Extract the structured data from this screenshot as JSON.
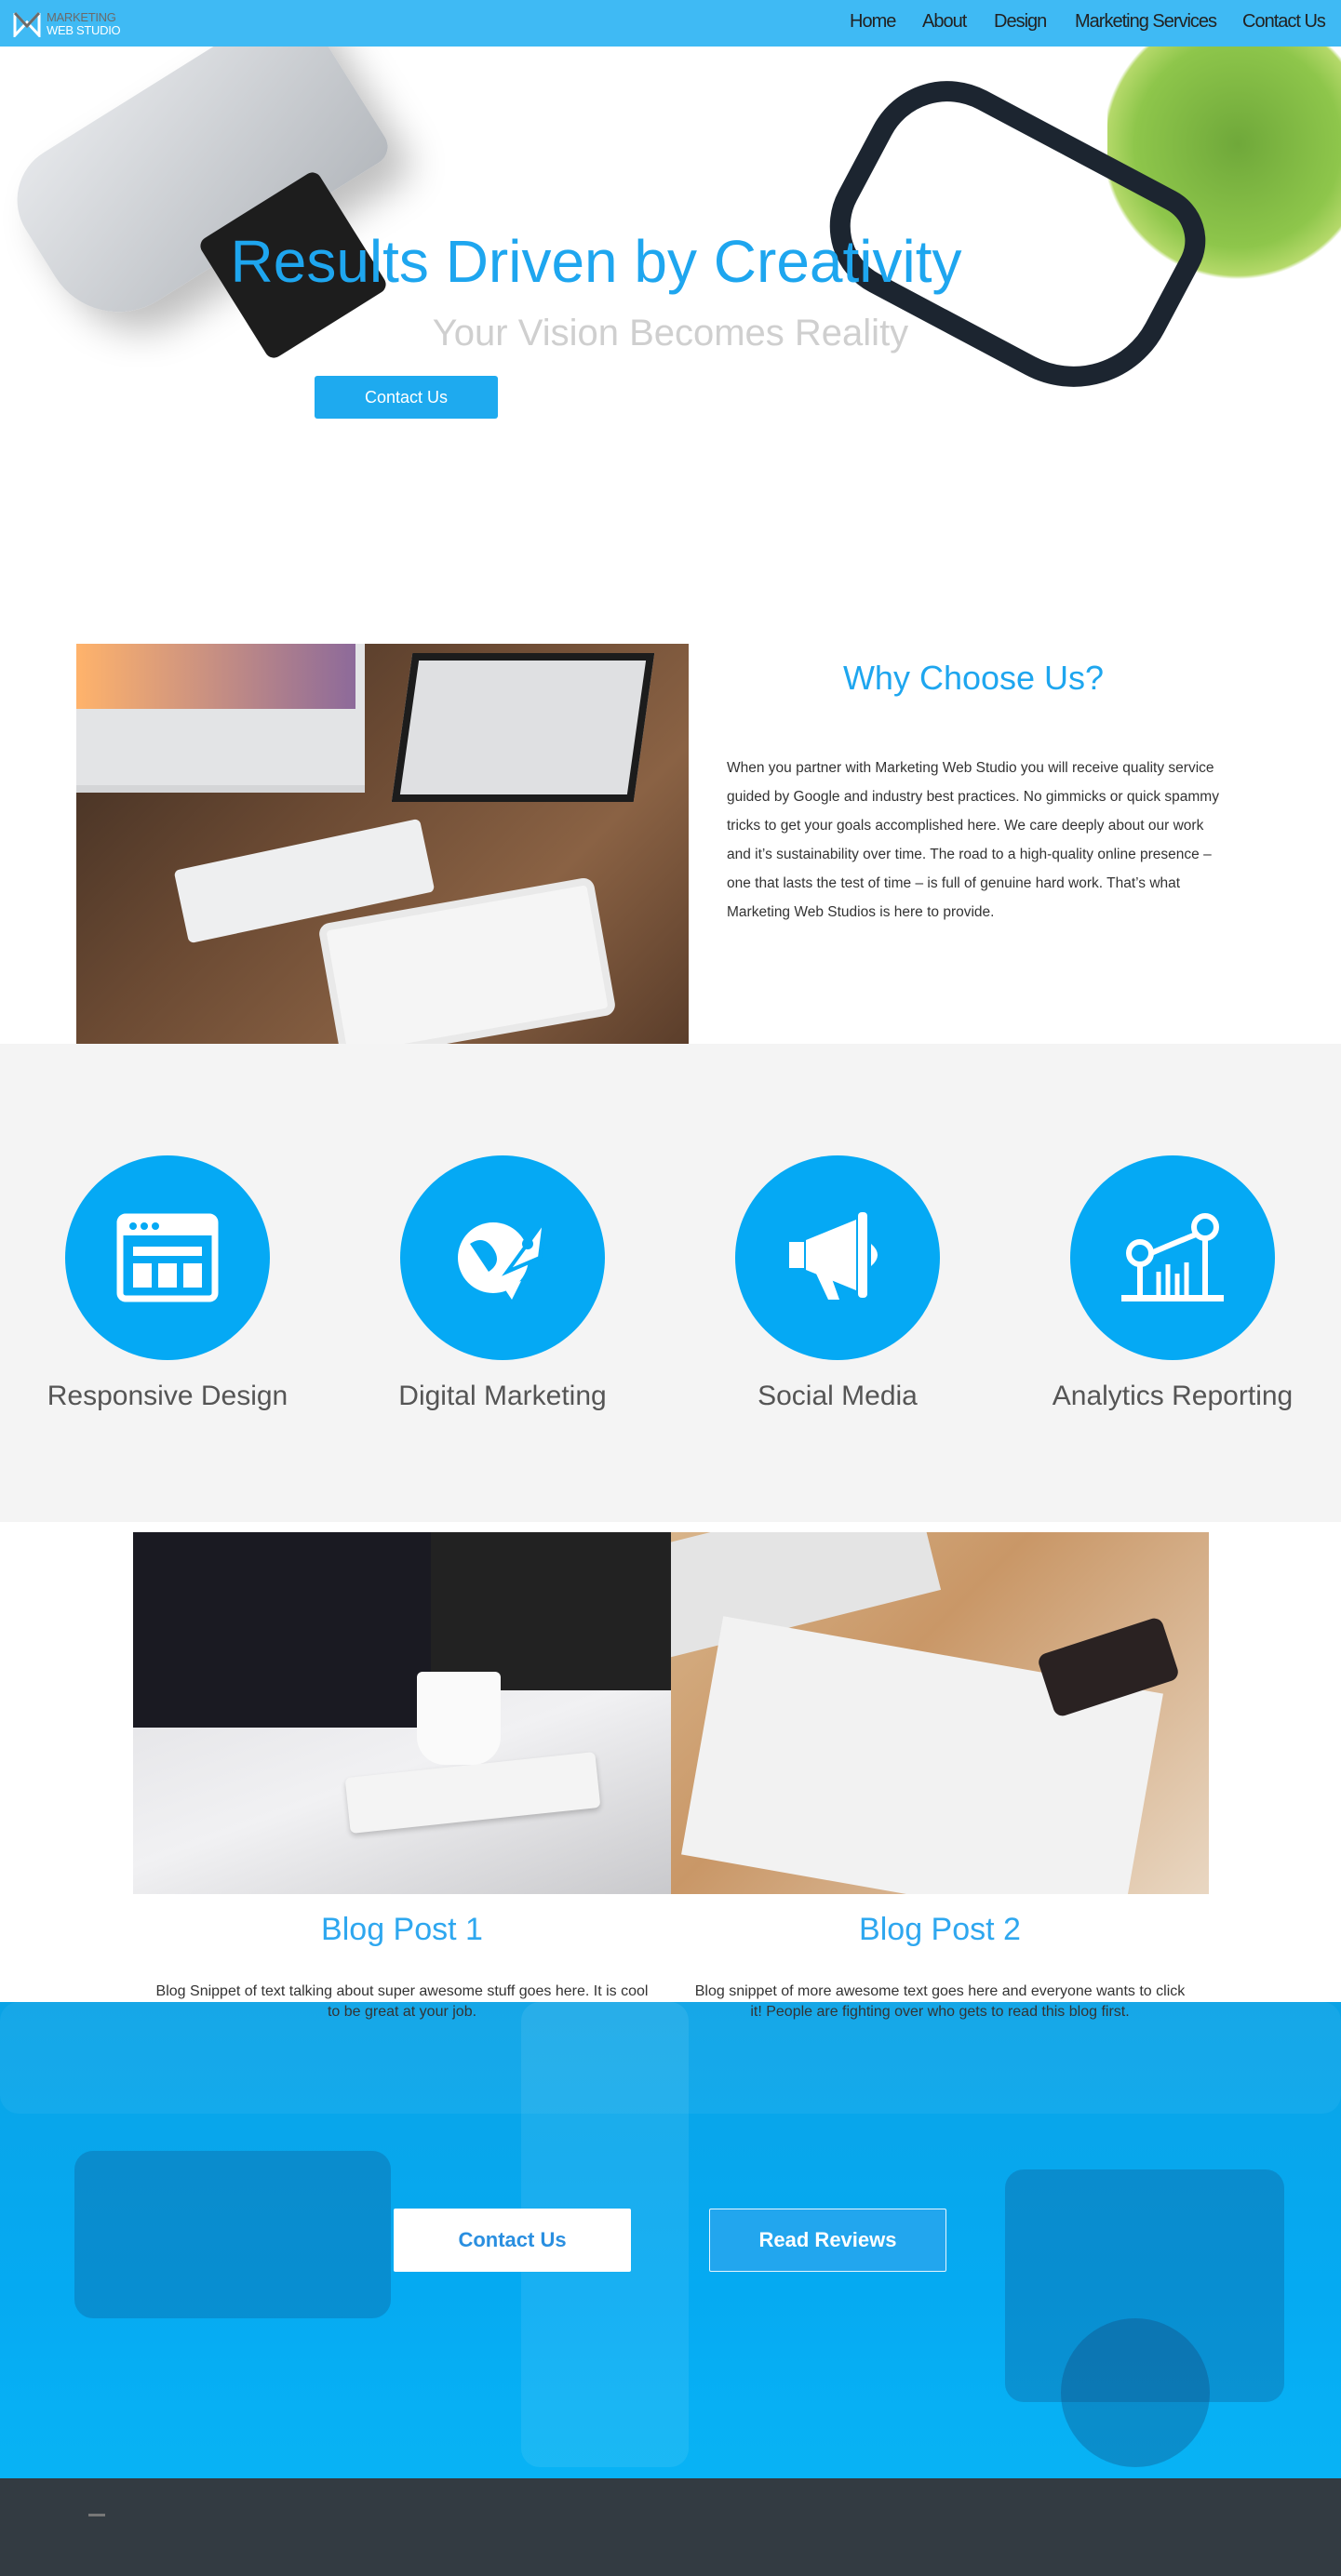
{
  "nav": {
    "logo_line1": "MARKETING",
    "logo_line2": "WEB STUDIO",
    "items": [
      "Home",
      "About",
      "Design",
      "Marketing Services",
      "Contact Us"
    ]
  },
  "hero": {
    "title": "Results Driven by Creativity",
    "subtitle": "Your Vision Becomes Reality",
    "button": "Contact Us"
  },
  "why": {
    "title": "Why Choose Us?",
    "text": "When you partner with Marketing Web Studio you will receive quality service guided by Google and industry best practices. No gimmicks or quick spammy tricks to get your goals accomplished here. We care deeply about our work and it’s sustainability over time. The road to a high-quality online presence – one that lasts the test of time – is full of genuine hard work. That’s what Marketing Web Studios is here to provide."
  },
  "services": [
    {
      "label": "Responsive Design",
      "icon": "browser-layout-icon"
    },
    {
      "label": "Digital Marketing",
      "icon": "globe-rocket-icon"
    },
    {
      "label": "Social Media",
      "icon": "megaphone-icon"
    },
    {
      "label": "Analytics Reporting",
      "icon": "analytics-chart-icon"
    }
  ],
  "blog": [
    {
      "title": "Blog Post 1",
      "snippet": "Blog Snippet of text talking about super awesome stuff goes here. It is cool to be great at your job."
    },
    {
      "title": "Blog Post 2",
      "snippet": "Blog snippet of more awesome text goes here and everyone wants to click it! People are fighting over who gets to read this blog first."
    }
  ],
  "cta": {
    "contact": "Contact Us",
    "reviews": "Read Reviews"
  },
  "colors": {
    "accent": "#1ea6ef",
    "nav": "#3fbaf4",
    "footer": "#333b42",
    "circle": "#05a9f4"
  }
}
